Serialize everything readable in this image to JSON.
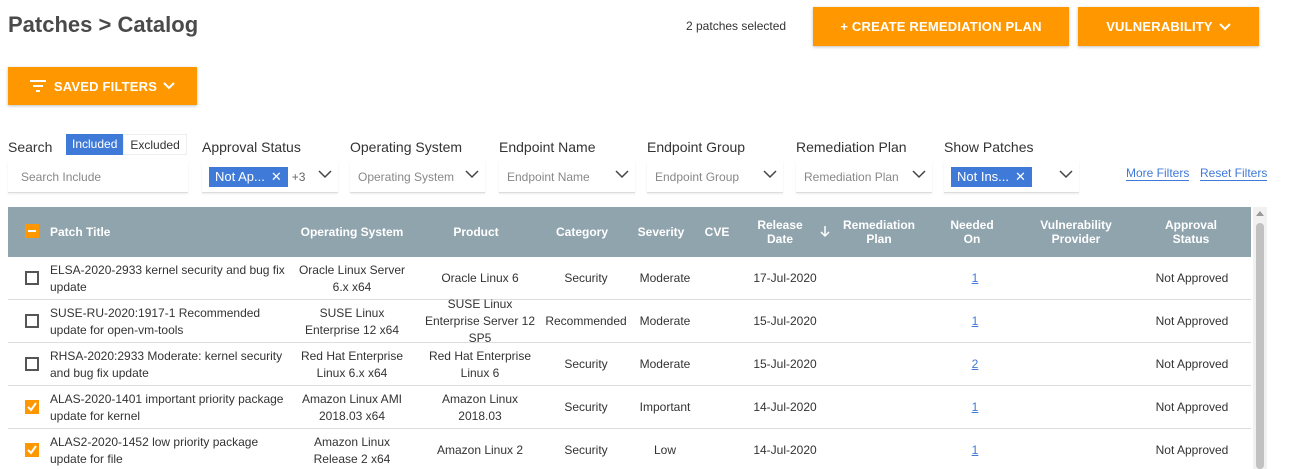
{
  "header": {
    "title": "Patches > Catalog",
    "selected_count": "2 patches selected",
    "create_label": "+ CREATE REMEDIATION PLAN",
    "vuln_label": "VULNERABILITY",
    "saved_filters_label": "SAVED FILTERS"
  },
  "filters": {
    "search_label": "Search",
    "included_label": "Included",
    "excluded_label": "Excluded",
    "search_placeholder": "Search Include",
    "approval_label": "Approval Status",
    "approval_chip": "Not Ap...",
    "approval_more": "+3",
    "os_label": "Operating System",
    "os_placeholder": "Operating System",
    "endpoint_label": "Endpoint Name",
    "endpoint_placeholder": "Endpoint Name",
    "group_label": "Endpoint Group",
    "group_placeholder": "Endpoint Group",
    "plan_label": "Remediation Plan",
    "plan_placeholder": "Remediation Plan",
    "show_label": "Show Patches",
    "show_chip": "Not Ins...",
    "more_filters": "More Filters",
    "reset_filters": "Reset Filters"
  },
  "table": {
    "columns": [
      "Patch Title",
      "Operating System",
      "Product",
      "Category",
      "Severity",
      "CVE",
      "Release Date",
      "Remediation Plan",
      "Needed On",
      "Vulnerability Provider",
      "Approval Status"
    ],
    "rows": [
      {
        "checked": false,
        "title": "ELSA-2020-2933 kernel security and bug fix update",
        "os": "Oracle Linux Server 6.x x64",
        "product": "Oracle Linux 6",
        "category": "Security",
        "severity": "Moderate",
        "cve": "",
        "release": "17-Jul-2020",
        "plan": "",
        "needed": "1",
        "provider": "",
        "approval": "Not Approved"
      },
      {
        "checked": false,
        "title": "SUSE-RU-2020:1917-1 Recommended update for open-vm-tools",
        "os": "SUSE Linux Enterprise 12 x64",
        "product": "SUSE Linux Enterprise Server 12 SP5",
        "category": "Recommended",
        "severity": "Moderate",
        "cve": "",
        "release": "15-Jul-2020",
        "plan": "",
        "needed": "1",
        "provider": "",
        "approval": "Not Approved"
      },
      {
        "checked": false,
        "title": "RHSA-2020:2933 Moderate: kernel security and bug fix update",
        "os": "Red Hat Enterprise Linux 6.x x64",
        "product": "Red Hat Enterprise Linux 6",
        "category": "Security",
        "severity": "Moderate",
        "cve": "",
        "release": "15-Jul-2020",
        "plan": "",
        "needed": "2",
        "provider": "",
        "approval": "Not Approved"
      },
      {
        "checked": true,
        "title": "ALAS-2020-1401 important priority package update for kernel",
        "os": "Amazon Linux AMI 2018.03 x64",
        "product": "Amazon Linux 2018.03",
        "category": "Security",
        "severity": "Important",
        "cve": "",
        "release": "14-Jul-2020",
        "plan": "",
        "needed": "1",
        "provider": "",
        "approval": "Not Approved"
      },
      {
        "checked": true,
        "title": "ALAS2-2020-1452 low priority package update for file",
        "os": "Amazon Linux Release 2 x64",
        "product": "Amazon Linux 2",
        "category": "Security",
        "severity": "Low",
        "cve": "",
        "release": "14-Jul-2020",
        "plan": "",
        "needed": "1",
        "provider": "",
        "approval": "Not Approved"
      }
    ]
  },
  "colors": {
    "accent": "#ff9800",
    "chip": "#3f7ad8",
    "table_header": "#90a4ae"
  }
}
